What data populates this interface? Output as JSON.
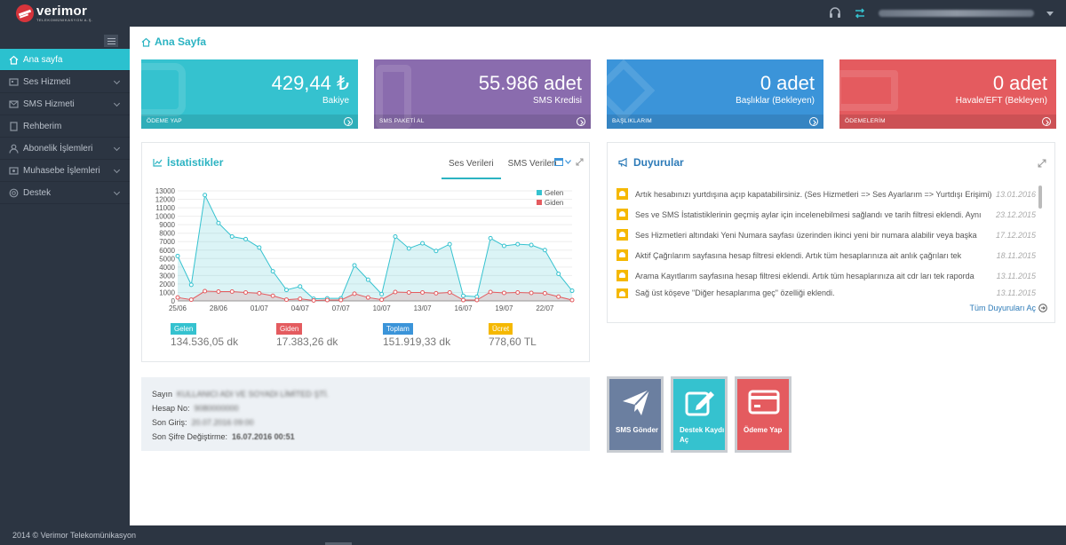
{
  "app": {
    "logo_name": "verimor",
    "logo_sub": "TELEKOMÜNIKASYON A.Ş."
  },
  "sidebar": {
    "items": [
      {
        "label": "Ana sayfa",
        "icon": "home-icon",
        "active": true
      },
      {
        "label": "Ses Hizmeti",
        "icon": "phone-icon",
        "active": false
      },
      {
        "label": "SMS Hizmeti",
        "icon": "sms-icon",
        "active": false
      },
      {
        "label": "Rehberim",
        "icon": "contacts-icon",
        "active": false
      },
      {
        "label": "Abonelik İşlemleri",
        "icon": "user-icon",
        "active": false
      },
      {
        "label": "Muhasebe İşlemleri",
        "icon": "accounting-icon",
        "active": false
      },
      {
        "label": "Destek",
        "icon": "support-icon",
        "active": false
      }
    ]
  },
  "page": {
    "title": "Ana Sayfa"
  },
  "tiles": [
    {
      "value": "429,44 ₺",
      "label": "Bakiye",
      "footer": "ÖDEME YAP",
      "color": "#35c2cf"
    },
    {
      "value": "55.986 adet",
      "label": "SMS Kredisi",
      "footer": "SMS PAKETİ AL",
      "color": "#8a6cae"
    },
    {
      "value": "0 adet",
      "label": "Başlıklar (Bekleyen)",
      "footer": "BAŞLIKLARIM",
      "color": "#3b94d9"
    },
    {
      "value": "0 adet",
      "label": "Havale/EFT (Bekleyen)",
      "footer": "ÖDEMELERİM",
      "color": "#e45b5f"
    }
  ],
  "stats_panel": {
    "title": "İstatistikler",
    "tabs": [
      "Ses Verileri",
      "SMS Verileri"
    ],
    "summary": [
      {
        "label": "Gelen",
        "value": "134.536,05 dk",
        "color": "#35c2cf"
      },
      {
        "label": "Giden",
        "value": "17.383,26 dk",
        "color": "#e45b5f"
      },
      {
        "label": "Toplam",
        "value": "151.919,33 dk",
        "color": "#3b94d9"
      },
      {
        "label": "Ücret",
        "value": "778,60 TL",
        "color": "#f5b800"
      }
    ]
  },
  "chart_data": {
    "type": "area",
    "x": [
      "25/06",
      "26/06",
      "27/06",
      "28/06",
      "29/06",
      "30/06",
      "01/07",
      "02/07",
      "03/07",
      "04/07",
      "05/07",
      "06/07",
      "07/07",
      "08/07",
      "09/07",
      "10/07",
      "11/07",
      "12/07",
      "13/07",
      "14/07",
      "15/07",
      "16/07",
      "17/07",
      "18/07",
      "19/07",
      "20/07",
      "21/07",
      "22/07",
      "23/07",
      "24/07"
    ],
    "x_tick_labels": [
      "25/06",
      "28/06",
      "01/07",
      "04/07",
      "07/07",
      "10/07",
      "13/07",
      "16/07",
      "19/07",
      "22/07"
    ],
    "y_ticks": [
      0,
      1000,
      2000,
      3000,
      4000,
      5000,
      6000,
      7000,
      8000,
      9000,
      10000,
      11000,
      12000,
      13000
    ],
    "ylim": [
      0,
      13000
    ],
    "legend_position": "top-right",
    "series": [
      {
        "name": "Gelen",
        "color": "#35c2cf",
        "values": [
          5300,
          1900,
          12500,
          9200,
          7600,
          7300,
          6300,
          3500,
          1300,
          1700,
          250,
          300,
          300,
          4200,
          2500,
          800,
          7600,
          6200,
          6800,
          5900,
          6700,
          600,
          500,
          7400,
          6500,
          6700,
          6600,
          6000,
          3200,
          1200
        ]
      },
      {
        "name": "Giden",
        "color": "#e45b5f",
        "values": [
          400,
          150,
          1150,
          1100,
          1100,
          1000,
          900,
          600,
          150,
          250,
          50,
          100,
          100,
          850,
          400,
          150,
          1050,
          1000,
          1000,
          900,
          1000,
          100,
          100,
          1050,
          950,
          1000,
          950,
          900,
          500,
          100
        ]
      }
    ]
  },
  "announcements": {
    "title": "Duyurular",
    "items": [
      {
        "text": "Artık hesabınızı yurtdışına açıp kapatabilirsiniz. (Ses Hizmetleri => Ses Ayarlarım => Yurtdışı Erişimi)",
        "date": "13.01.2016"
      },
      {
        "text": "Ses ve SMS İstatistiklerinin geçmiş aylar için incelenebilmesi sağlandı ve tarih filtresi eklendi. Aynı",
        "date": "23.12.2015"
      },
      {
        "text": "Ses Hizmetleri altındaki Yeni Numara sayfası üzerinden ikinci yeni bir numara alabilir veya başka",
        "date": "17.12.2015"
      },
      {
        "text": "Aktif Çağrılarım sayfasına hesap filtresi eklendi. Artık tüm hesaplarınıza ait anlık çağrıları tek",
        "date": "18.11.2015"
      },
      {
        "text": "Arama Kayıtlarım sayfasına hesap filtresi eklendi. Artık tüm hesaplarınıza ait cdr ları tek raporda",
        "date": "13.11.2015"
      },
      {
        "text": "Sağ üst köşeve \"Diğer hesaplarıma geç\" özelliği eklendi.",
        "date": "13.11.2015"
      }
    ],
    "all_link": "Tüm Duyuruları Aç"
  },
  "account": {
    "rows": [
      {
        "label": "Sayın",
        "value": "KULLANICI ADI VE SOYADI LİMİTED ŞTİ."
      },
      {
        "label": "Hesap No:",
        "value": "9080000000"
      },
      {
        "label": "Son Giriş:",
        "value": "20.07.2016 09:00"
      },
      {
        "label": "Son Şifre Değiştirme:",
        "value": "16.07.2016 00:51"
      }
    ]
  },
  "quick_actions": [
    {
      "label": "SMS Gönder",
      "icon": "paper-plane-icon",
      "color": "#6b7fa0"
    },
    {
      "label": "Destek Kaydı Aç",
      "icon": "edit-icon",
      "color": "#35c2cf"
    },
    {
      "label": "Ödeme Yap",
      "icon": "credit-card-icon",
      "color": "#e45b5f"
    }
  ],
  "footer": {
    "text": "2014 © Verimor Telekomünikasyon"
  }
}
